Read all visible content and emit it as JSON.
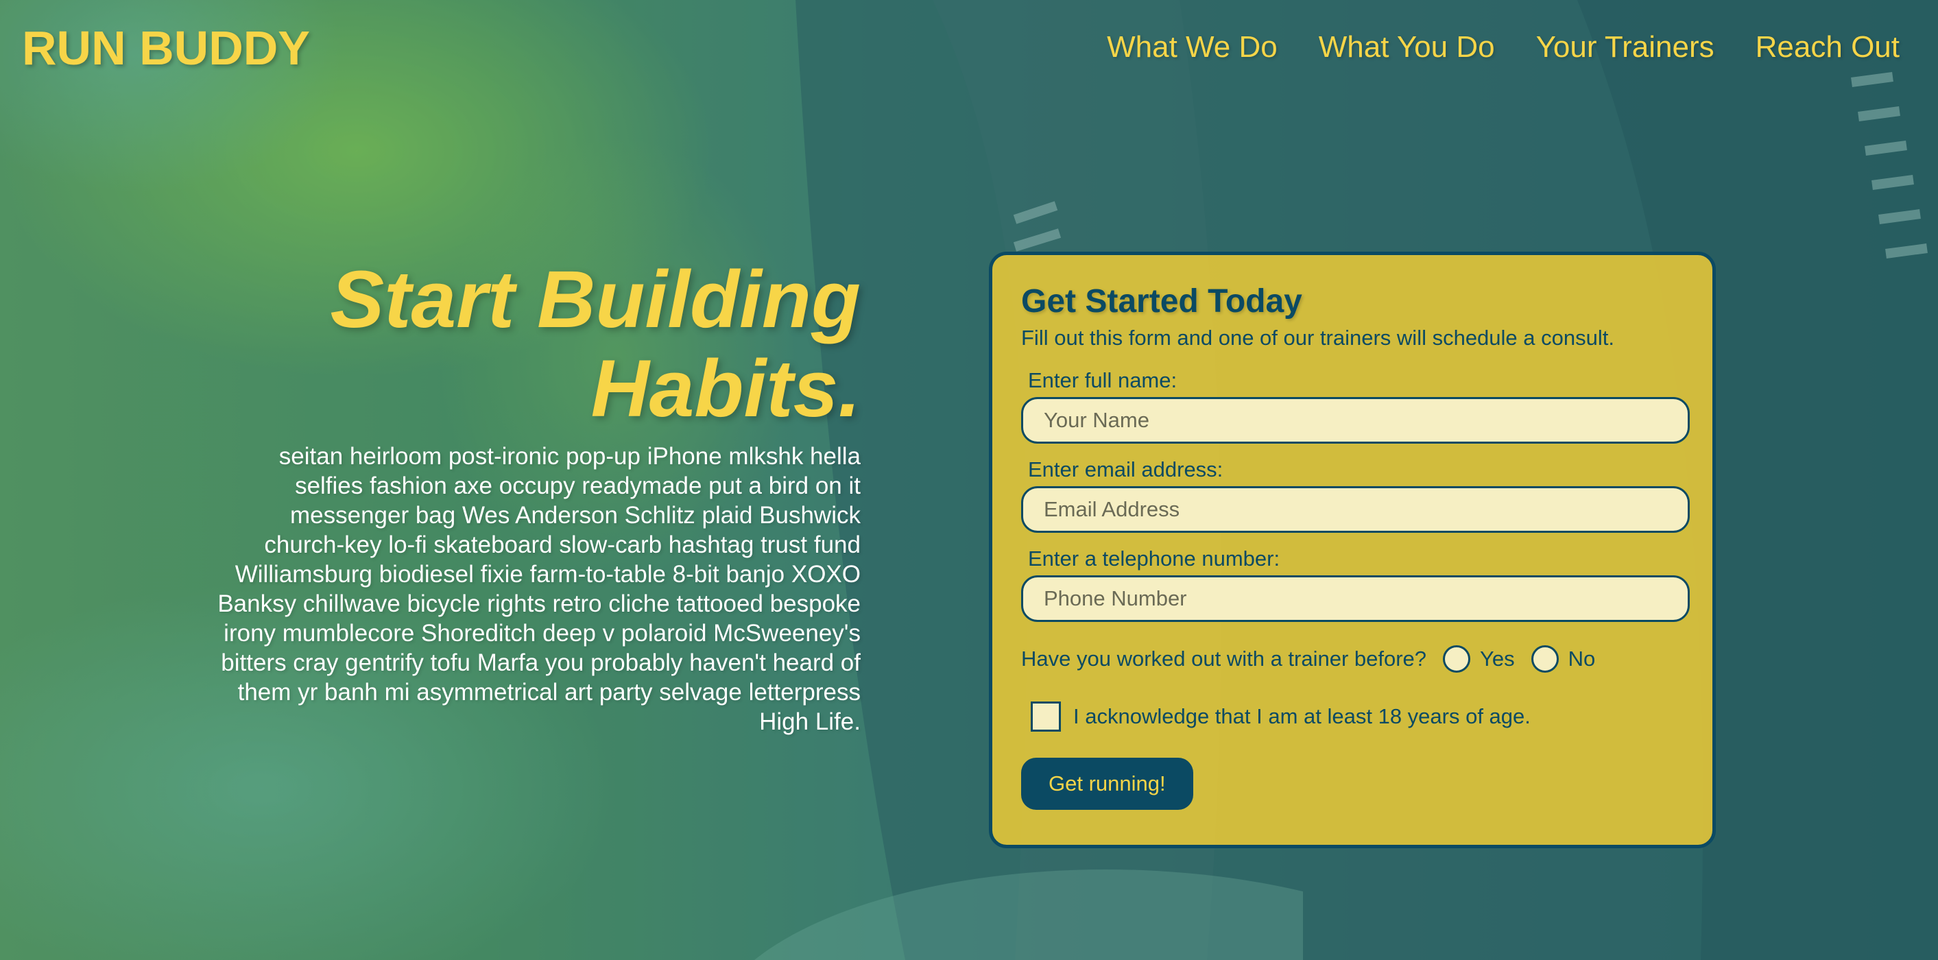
{
  "header": {
    "logo": "RUN BUDDY",
    "nav": [
      "What We Do",
      "What You Do",
      "Your Trainers",
      "Reach Out"
    ]
  },
  "hero": {
    "title_line1": "Start Building",
    "title_line2": "Habits.",
    "body": "seitan heirloom post-ironic pop-up iPhone mlkshk hella selfies fashion axe occupy readymade put a bird on it messenger bag Wes Anderson Schlitz plaid Bushwick church-key lo-fi skateboard slow-carb hashtag trust fund Williamsburg biodiesel fixie farm-to-table 8-bit banjo XOXO Banksy chillwave bicycle rights retro cliche tattooed bespoke irony mumblecore Shoreditch deep v polaroid McSweeney's bitters cray gentrify tofu Marfa you probably haven't heard of them yr banh mi asymmetrical art party selvage letterpress High Life."
  },
  "form": {
    "title": "Get Started Today",
    "subtitle": "Fill out this form and one of our trainers will schedule a consult.",
    "name": {
      "label": "Enter full name:",
      "placeholder": "Your Name",
      "value": ""
    },
    "email": {
      "label": "Enter email address:",
      "placeholder": "Email Address",
      "value": ""
    },
    "phone": {
      "label": "Enter a telephone number:",
      "placeholder": "Phone Number",
      "value": ""
    },
    "trainer_question": "Have you worked out with a trainer before?",
    "trainer_options": [
      "Yes",
      "No"
    ],
    "acknowledge": "I acknowledge that I am at least 18 years of age.",
    "submit": "Get running!"
  },
  "colors": {
    "accent": "#f7d548",
    "primary": "#0b4a63",
    "card_bg": "#e8c838",
    "input_bg": "#f6efc3"
  }
}
